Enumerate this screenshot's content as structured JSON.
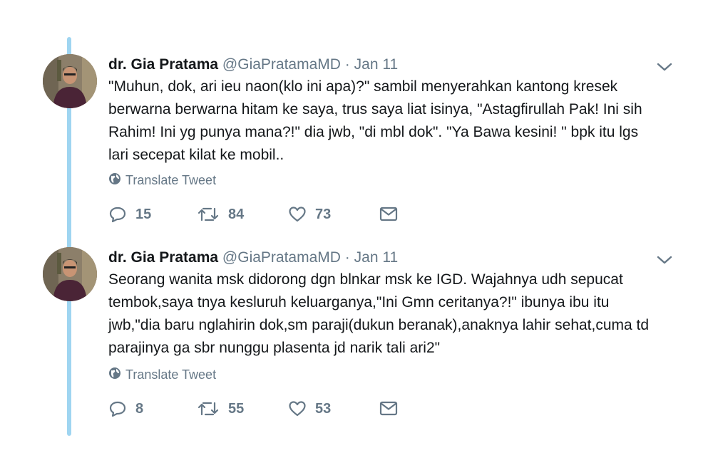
{
  "tweets": [
    {
      "name": "dr. Gia Pratama",
      "handle": "@GiaPratamaMD",
      "separator": "·",
      "date": "Jan 11",
      "lines": [
        "\"Muhun, dok, ari ieu naon(klo ini apa)?\" sambil menyerahkan kantong kresek",
        "berwarna berwarna hitam ke saya, trus saya liat isinya, \"Astagfirullah Pak! Ini sih",
        "Rahim! Ini yg punya mana?!\" dia jwb, \"di mbl dok\". \"Ya Bawa kesini! \" bpk itu lgs",
        "lari secepat kilat ke mobil.."
      ],
      "translate_label": "Translate Tweet",
      "replies": "15",
      "retweets": "84",
      "likes": "73"
    },
    {
      "name": "dr. Gia Pratama",
      "handle": "@GiaPratamaMD",
      "separator": "·",
      "date": "Jan 11",
      "lines": [
        "Seorang wanita msk didorong dgn blnkar msk ke IGD. Wajahnya udh sepucat",
        "tembok,saya tnya kesluruh keluarganya,\"Ini Gmn ceritanya?!\" ibunya ibu itu",
        "jwb,\"dia baru nglahirin dok,sm paraji(dukun beranak),anaknya lahir sehat,cuma td",
        "parajinya ga sbr nunggu plasenta jd narik tali ari2\""
      ],
      "translate_label": "Translate Tweet",
      "replies": "8",
      "retweets": "55",
      "likes": "53"
    }
  ],
  "colors": {
    "thread_line": "#9fd5f1",
    "secondary_text": "#657786",
    "primary_text": "#14171a"
  },
  "icons": [
    "chevron-down-icon",
    "globe-icon",
    "reply-icon",
    "retweet-icon",
    "like-icon",
    "message-icon"
  ]
}
